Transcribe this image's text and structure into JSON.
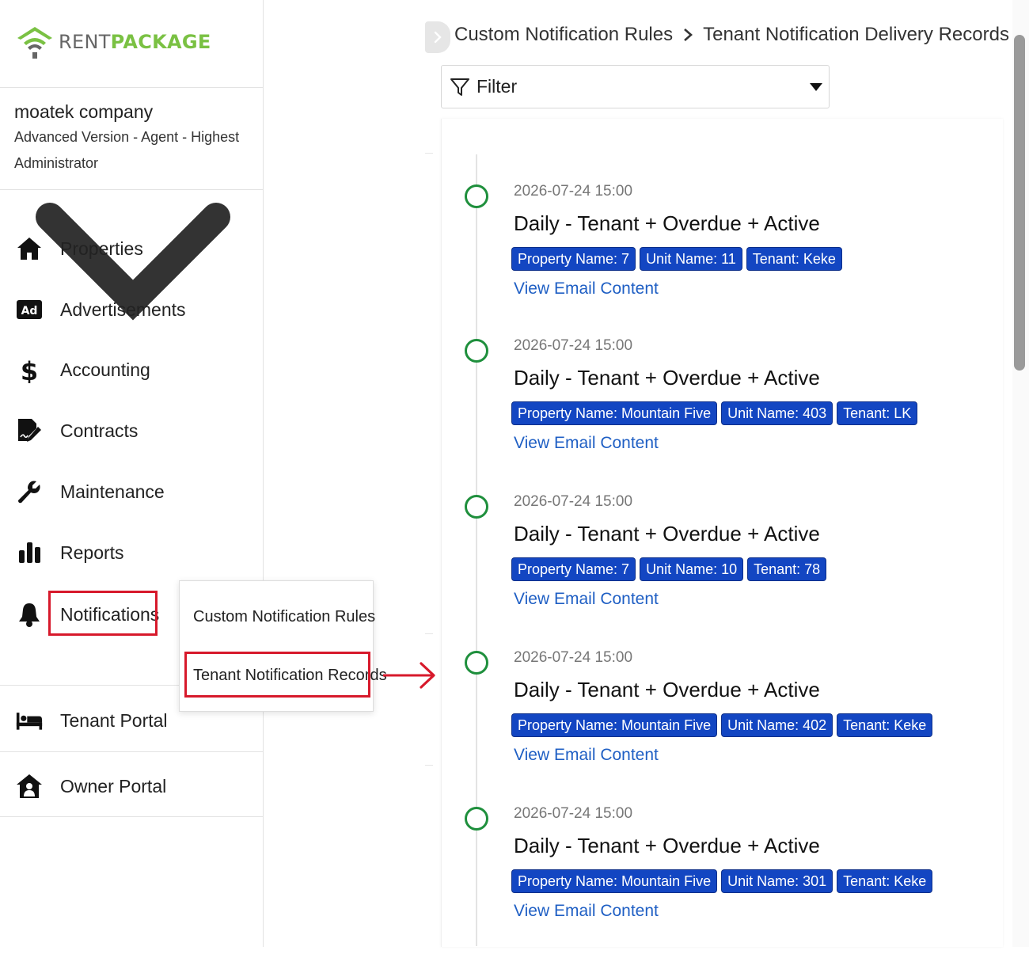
{
  "brand": {
    "rent": "RENT",
    "package": "PACKAGE",
    "logo_green": "#7ac143"
  },
  "account": {
    "company": "moatek company",
    "plan": "Advanced Version - Agent - Highest",
    "role": "Administrator"
  },
  "nav": {
    "properties": "Properties",
    "advertisements": "Advertisements",
    "ad_badge": "Ad",
    "accounting": "Accounting",
    "contracts": "Contracts",
    "maintenance": "Maintenance",
    "reports": "Reports",
    "notifications": "Notifications",
    "tenant_portal": "Tenant Portal",
    "owner_portal": "Owner Portal"
  },
  "submenu": {
    "custom_rules": "Custom Notification Rules",
    "tenant_records": "Tenant Notification Records"
  },
  "breadcrumb": {
    "parent": "Custom Notification Rules",
    "current": "Tenant Notification Delivery Records"
  },
  "filter": {
    "label": "Filter"
  },
  "records": [
    {
      "time": "2026-07-24 15:00",
      "title": "Daily - Tenant + Overdue + Active",
      "property": "Property Name: 7",
      "unit": "Unit Name: 11",
      "tenant": "Tenant: Keke",
      "link": "View Email Content"
    },
    {
      "time": "2026-07-24 15:00",
      "title": "Daily - Tenant + Overdue + Active",
      "property": "Property Name: Mountain Five",
      "unit": "Unit Name: 403",
      "tenant": "Tenant: LK",
      "link": "View Email Content"
    },
    {
      "time": "2026-07-24 15:00",
      "title": "Daily - Tenant + Overdue + Active",
      "property": "Property Name: 7",
      "unit": "Unit Name: 10",
      "tenant": "Tenant: 78",
      "link": "View Email Content"
    },
    {
      "time": "2026-07-24 15:00",
      "title": "Daily - Tenant + Overdue + Active",
      "property": "Property Name: Mountain Five",
      "unit": "Unit Name: 402",
      "tenant": "Tenant: Keke",
      "link": "View Email Content"
    },
    {
      "time": "2026-07-24 15:00",
      "title": "Daily - Tenant + Overdue + Active",
      "property": "Property Name: Mountain Five",
      "unit": "Unit Name: 301",
      "tenant": "Tenant: Keke",
      "link": "View Email Content"
    }
  ],
  "colors": {
    "tag_blue": "#1346c2",
    "link_blue": "#1f5fc4",
    "dot_green": "#1e8f3c",
    "highlight_red": "#d7192b"
  }
}
